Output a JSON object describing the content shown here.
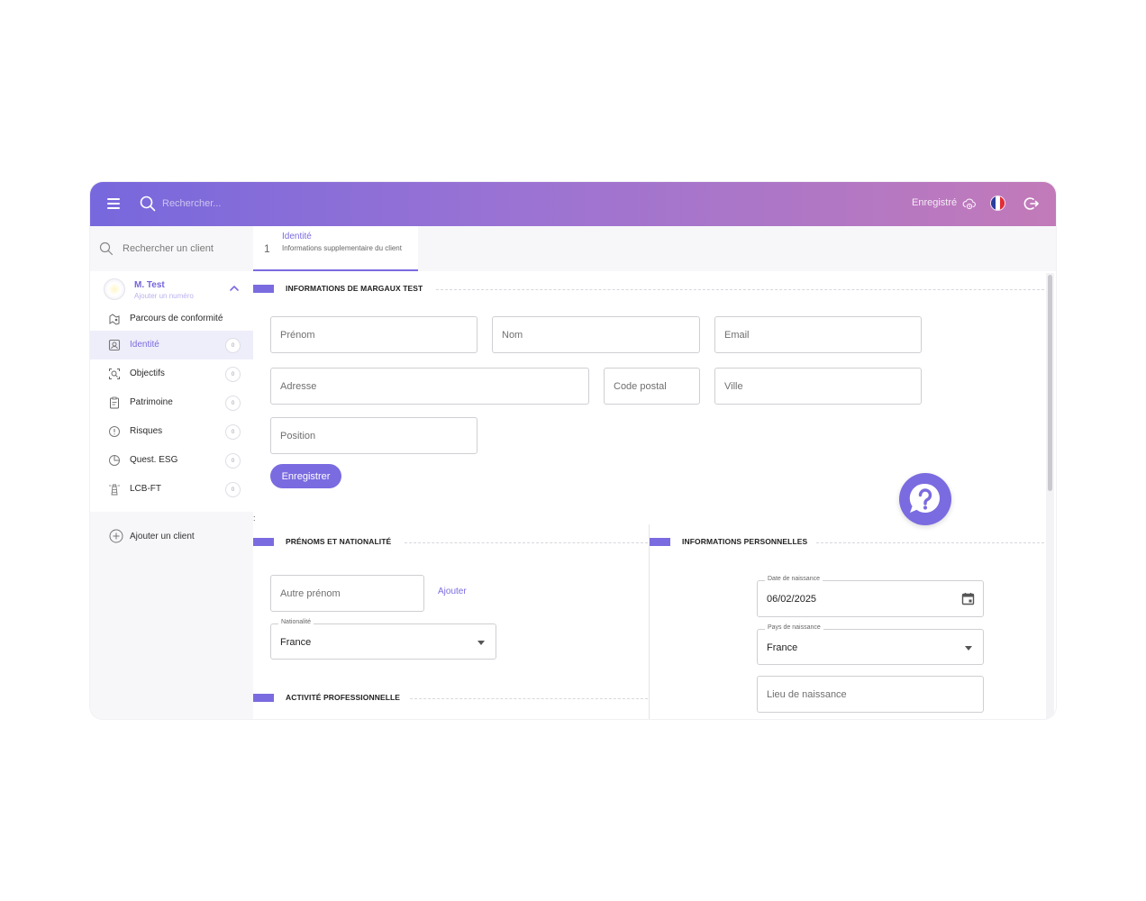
{
  "topbar": {
    "search_placeholder": "Rechercher...",
    "saved_status": "Enregistré"
  },
  "sidebar": {
    "search_placeholder": "Rechercher un client",
    "client": {
      "name": "M. Test",
      "add_number": "Ajouter un numéro"
    },
    "items": [
      {
        "label": "Parcours de conformité",
        "badge": "",
        "icon": "route-icon"
      },
      {
        "label": "Identité",
        "badge": "0",
        "icon": "id-card-icon"
      },
      {
        "label": "Objectifs",
        "badge": "0",
        "icon": "target-search-icon"
      },
      {
        "label": "Patrimoine",
        "badge": "0",
        "icon": "clipboard-icon"
      },
      {
        "label": "Risques",
        "badge": "0",
        "icon": "warning-circle-icon"
      },
      {
        "label": "Quest. ESG",
        "badge": "0",
        "icon": "pie-chart-icon"
      },
      {
        "label": "LCB-FT",
        "badge": "0",
        "icon": "lighthouse-icon"
      }
    ],
    "add_client": "Ajouter un client"
  },
  "tab": {
    "number": "1",
    "title": "Identité",
    "subtitle": "Informations supplementaire du client"
  },
  "sections": {
    "info": "INFORMATIONS DE MARGAUX TEST",
    "names": "PRÉNOMS ET NATIONALITÉ",
    "personal": "INFORMATIONS PERSONNELLES",
    "activity": "ACTIVITÉ PROFESSIONNELLE"
  },
  "form": {
    "prenom": "Prénom",
    "nom": "Nom",
    "email": "Email",
    "adresse": "Adresse",
    "code_postal": "Code postal",
    "ville": "Ville",
    "position": "Position",
    "save_button": "Enregistrer",
    "autre_prenom": "Autre prénom",
    "ajouter": "Ajouter",
    "nationalite_label": "Nationalité",
    "nationalite_value": "France",
    "date_naissance_label": "Date de naissance",
    "date_naissance_value": "06/02/2025",
    "pays_naissance_label": "Pays de naissance",
    "pays_naissance_value": "France",
    "lieu_naissance": "Lieu de naissance"
  },
  "colors": {
    "accent": "#7a6be0",
    "gradient_start": "#7768dd",
    "gradient_end": "#c27ab9"
  }
}
